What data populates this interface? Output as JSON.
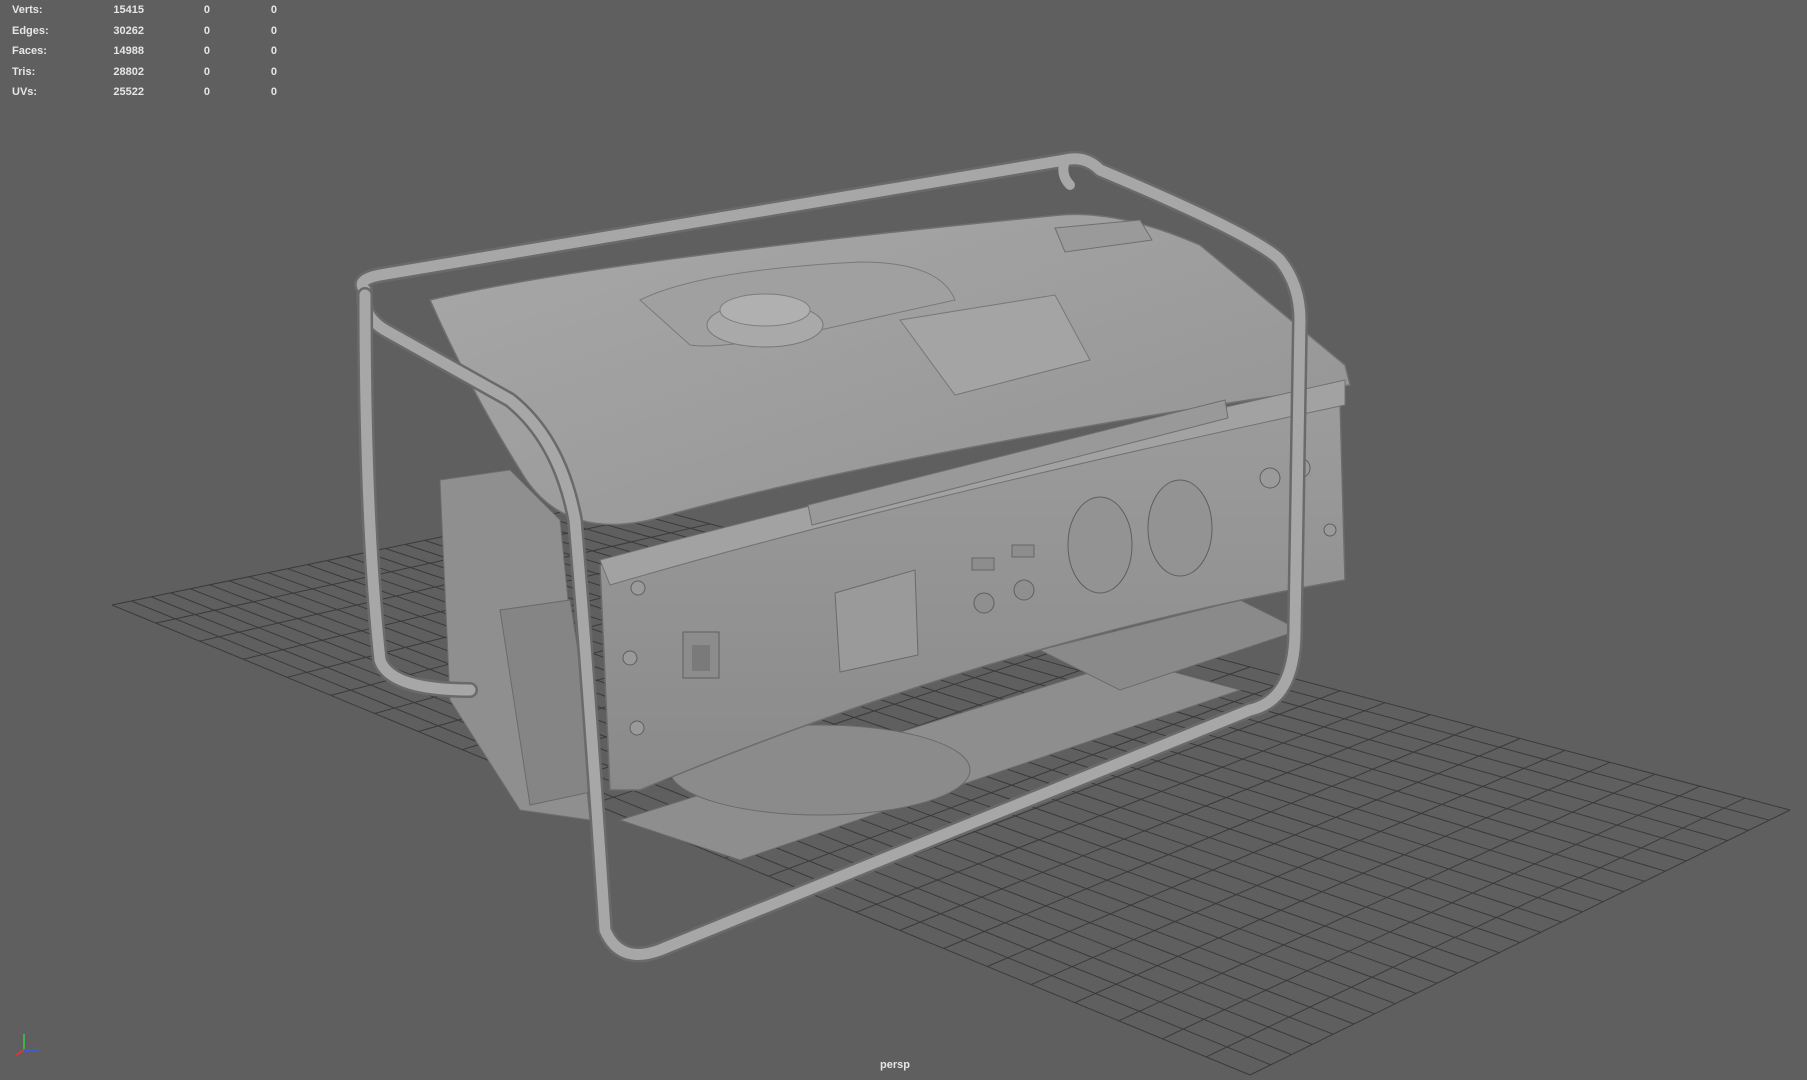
{
  "hud": {
    "rows": [
      {
        "label": "Verts:",
        "total": "15415",
        "selected": "0",
        "component": "0"
      },
      {
        "label": "Edges:",
        "total": "30262",
        "selected": "0",
        "component": "0"
      },
      {
        "label": "Faces:",
        "total": "14988",
        "selected": "0",
        "component": "0"
      },
      {
        "label": "Tris:",
        "total": "28802",
        "selected": "0",
        "component": "0"
      },
      {
        "label": "UVs:",
        "total": "25522",
        "selected": "0",
        "component": "0"
      }
    ]
  },
  "viewport": {
    "camera": "persp",
    "background_color": "#5f5f5f",
    "grid_color": "#3a3a3a",
    "model_color": "#9a9a9a",
    "model_subject": "portable-generator"
  },
  "axis_gizmo": {
    "x_color": "#d43a3a",
    "y_color": "#3fb04a",
    "z_color": "#3a5fd4"
  }
}
